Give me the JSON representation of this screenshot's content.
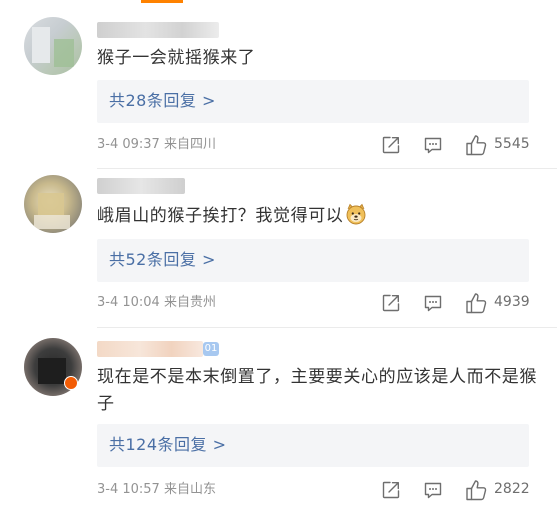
{
  "comments": [
    {
      "text": "猴子一会就摇猴来了",
      "reply_label": "共28条回复 >",
      "time_location": "3-4 09:37 来自四川",
      "likes": "5545"
    },
    {
      "text": "峨眉山的猴子挨打？我觉得可以",
      "reply_label": "共52条回复 >",
      "time_location": "3-4 10:04 来自贵州",
      "likes": "4939"
    },
    {
      "text": "现在是不是本末倒置了，主要要关心的应该是人而不是猴子",
      "reply_label": "共124条回复 >",
      "time_location": "3-4 10:57 来自山东",
      "likes": "2822",
      "badge_text": "01"
    }
  ],
  "icons": {
    "share": "share-icon",
    "reply": "comment-icon",
    "like": "thumbs-up-icon",
    "emoji": "doge-emoji-icon"
  },
  "colors": {
    "accent": "#ff8200",
    "link": "#4a6fa5",
    "reply_bg": "#f4f5f7",
    "meta": "#939393",
    "like_count": "#6e6e6e"
  }
}
